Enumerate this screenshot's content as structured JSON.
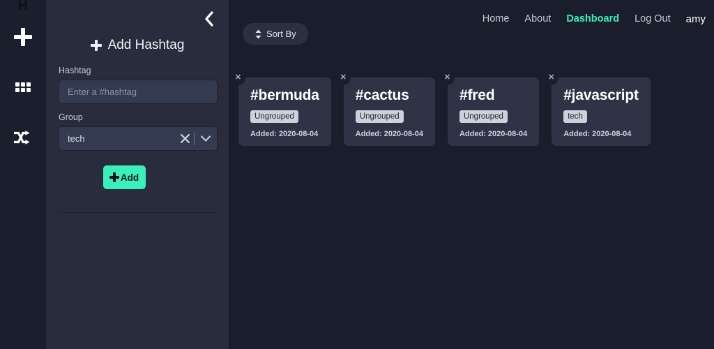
{
  "icon_rail": {
    "logo": "H",
    "buttons": [
      {
        "name": "add-icon",
        "label": "Add"
      },
      {
        "name": "grid-icon",
        "label": "Browse"
      },
      {
        "name": "shuffle-icon",
        "label": "Shuffle"
      }
    ]
  },
  "side_panel": {
    "collapse_label": "‹",
    "title": "Add Hashtag",
    "hashtag_field": {
      "label": "Hashtag",
      "value": "",
      "placeholder": "Enter a #hashtag"
    },
    "group_field": {
      "label": "Group",
      "value": "tech",
      "clear_label": "✕",
      "arrow_label": "⌄"
    },
    "add_button": "Add"
  },
  "topnav": {
    "links": [
      {
        "label": "Home",
        "active": false
      },
      {
        "label": "About",
        "active": false
      },
      {
        "label": "Dashboard",
        "active": true
      },
      {
        "label": "Log Out",
        "active": false
      }
    ],
    "user": "amy"
  },
  "toolbar": {
    "sort_label": "Sort By",
    "sort_icon": "↕"
  },
  "cards": [
    {
      "name": "bermuda",
      "title": "#bermuda",
      "group": "Ungrouped",
      "added": "Added: 2020-08-04",
      "close_label": "✕"
    },
    {
      "name": "cactus",
      "title": "#cactus",
      "group": "Ungrouped",
      "added": "Added: 2020-08-04",
      "close_label": "✕"
    },
    {
      "name": "fred",
      "title": "#fred",
      "group": "Ungrouped",
      "added": "Added: 2020-08-04",
      "close_label": "✕"
    },
    {
      "name": "javascript",
      "title": "#javascript",
      "group": "tech",
      "added": "Added: 2020-08-04",
      "close_label": "✕"
    }
  ],
  "colors": {
    "accent": "#3af0ba",
    "main_bg": "#1a1d2b",
    "panel_bg": "#282c3c",
    "card_bg": "#2e3346",
    "field_bg": "#343a50",
    "badge_bg": "#ccd1dc"
  }
}
